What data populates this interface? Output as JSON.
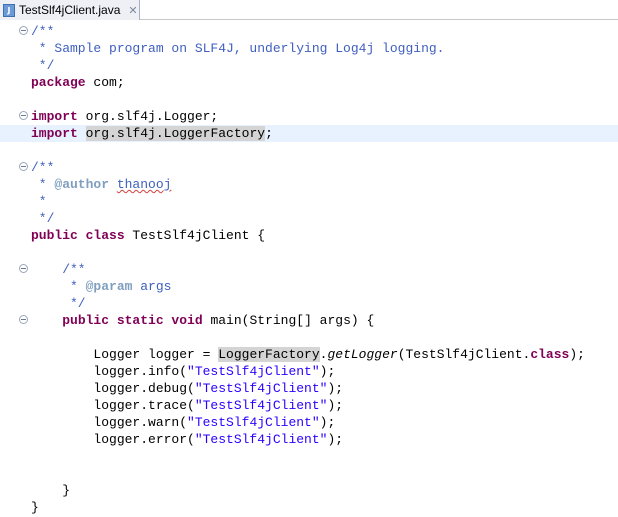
{
  "tab": {
    "title": "TestSlf4jClient.java",
    "close_glyph": "✕",
    "icon": "java-file-icon"
  },
  "code": {
    "l1": "/**",
    "l2": " * Sample program on SLF4J, underlying Log4j logging.",
    "l3": " */",
    "l4_kw": "package",
    "l4_rest": " com;",
    "l6_kw": "import",
    "l6_rest": " org.slf4j.Logger;",
    "l7_kw": "import",
    "l7_sp": " ",
    "l7_hl": "org.slf4j.LoggerFactory",
    "l7_end": ";",
    "l9": "/**",
    "l10_pre": " * ",
    "l10_tag": "@author",
    "l10_sp": " ",
    "l10_name": "thanooj",
    "l11": " *",
    "l12": " */",
    "l13_kw": "public class",
    "l13_rest": " TestSlf4jClient {",
    "l15": "    /**",
    "l16_pre": "     * ",
    "l16_tag": "@param",
    "l16_rest": " args",
    "l17": "     */",
    "l18_pre": "    ",
    "l18_kw": "public static void",
    "l18_rest": " main(String[] args) {",
    "l20_pre": "        Logger logger = ",
    "l20_hl": "LoggerFactory",
    "l20_dot": ".",
    "l20_method": "getLogger",
    "l20_mid": "(TestSlf4jClient.",
    "l20_kw": "class",
    "l20_end": ");",
    "l21_pre": "        logger.info(",
    "l21_str": "\"TestSlf4jClient\"",
    "l21_end": ");",
    "l22_pre": "        logger.debug(",
    "l22_str": "\"TestSlf4jClient\"",
    "l22_end": ");",
    "l23_pre": "        logger.trace(",
    "l23_str": "\"TestSlf4jClient\"",
    "l23_end": ");",
    "l24_pre": "        logger.warn(",
    "l24_str": "\"TestSlf4jClient\"",
    "l24_end": ");",
    "l25_pre": "        logger.error(",
    "l25_str": "\"TestSlf4jClient\"",
    "l25_end": ");",
    "l28": "    }",
    "l29": "}"
  },
  "colors": {
    "keyword": "#7f0055",
    "comment": "#3f5fbf",
    "javadoc_tag": "#7f9fbf",
    "string": "#2a00ff",
    "current_line": "#e8f2fe",
    "occurrence_highlight": "#d4d4d4"
  }
}
